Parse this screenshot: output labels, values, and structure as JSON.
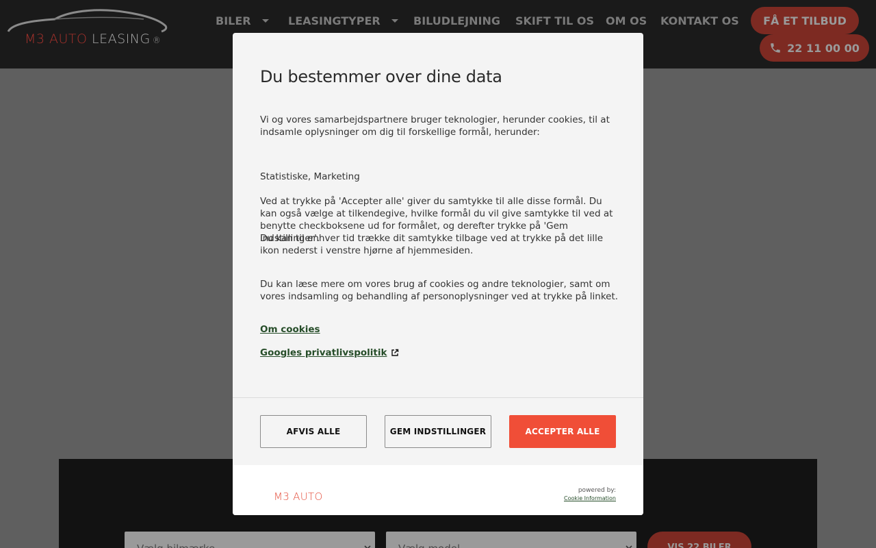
{
  "brand": {
    "logo_left": "M3 AUTO",
    "logo_right": "LEASING",
    "logo_mark": "®"
  },
  "nav": {
    "items": [
      {
        "label": "BILER",
        "has_dropdown": true
      },
      {
        "label": "LEASINGTYPER",
        "has_dropdown": true
      },
      {
        "label": "BILUDLEJNING",
        "has_dropdown": false
      },
      {
        "label": "SKIFT TIL OS",
        "has_dropdown": false
      },
      {
        "label": "OM OS",
        "has_dropdown": false
      },
      {
        "label": "KONTAKT OS",
        "has_dropdown": false
      }
    ],
    "quote_label": "FÅ ET TILBUD",
    "phone_label": "22 11 00 00"
  },
  "search": {
    "brand_placeholder": "Vælg bilmærke",
    "model_placeholder": "Vælg model",
    "submit_label": "VIS 22 BILER"
  },
  "consent": {
    "title": "Du bestemmer over dine data",
    "intro": "Vi og vores samarbejdspartnere bruger teknologier, herunder cookies, til at indsamle oplysninger om dig til forskellige formål, herunder:",
    "purposes": "Statistiske, Marketing",
    "body_1": "Ved at trykke på 'Accepter alle' giver du samtykke til alle disse formål. Du kan også vælge at tilkendegive, hvilke formål du vil give samtykke til ved at benytte checkboksene ud for formålet, og derefter trykke på 'Gem indstillinger'.",
    "body_2": "Du kan til enhver tid trække dit samtykke tilbage ved at trykke på det lille ikon nederst i venstre hjørne af hjemmesiden.",
    "body_3": "Du kan læse mere om vores brug af cookies og andre teknologier, samt om vores indsamling og behandling af personoplysninger ved at trykke på linket.",
    "link_cookies": "Om cookies",
    "link_google": "Googles privatlivspolitik",
    "btn_reject": "AFVIS ALLE",
    "btn_save": "GEM INDSTILLINGER",
    "btn_accept": "ACCEPTER ALLE",
    "footer_logo": "M3 AUTO",
    "powered_by": "powered by:",
    "provider": "Cookie Information"
  },
  "colors": {
    "accent": "#f04e37",
    "link": "#264d29",
    "header_bg": "#1a1a1a"
  },
  "icons": {
    "dropdown": "chevron-down-icon",
    "phone": "phone-icon",
    "external": "external-link-icon",
    "select_arrow": "chevron-down-icon"
  }
}
